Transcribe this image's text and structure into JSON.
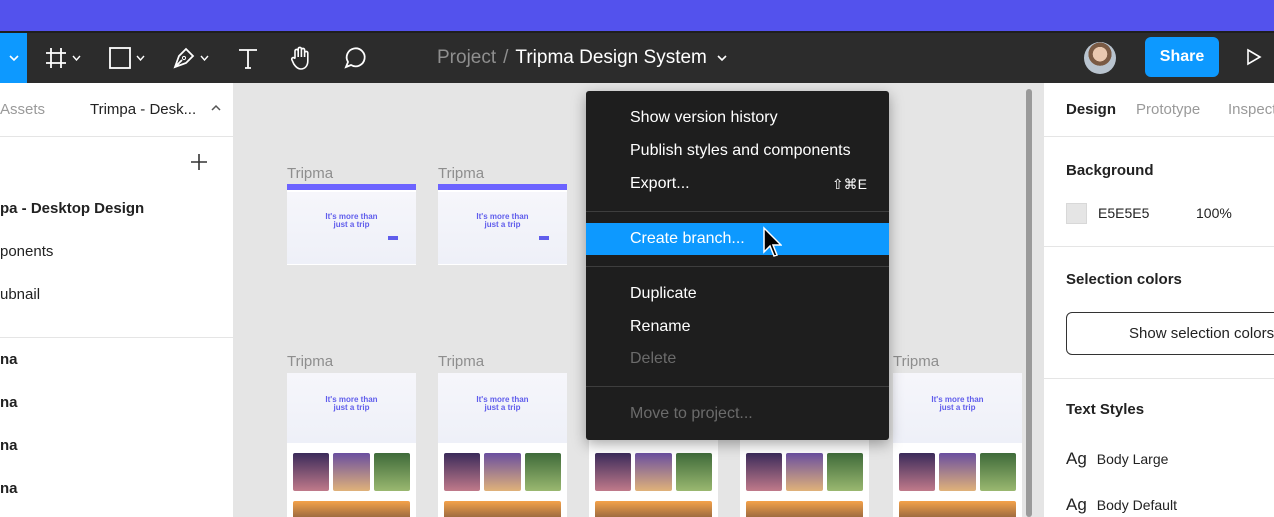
{
  "toolbar": {
    "project": "Project",
    "separator": "/",
    "title": "Tripma Design System",
    "share_label": "Share"
  },
  "left_panel": {
    "assets_tab": "Assets",
    "page_selector": "Trimpa - Desk...",
    "pages": [
      "pa - Desktop Design",
      "ponents",
      "ubnail"
    ],
    "layers": [
      "na",
      "na",
      "na",
      "na"
    ]
  },
  "canvas": {
    "frame_label": "Tripma",
    "hero_line1": "It's more than",
    "hero_line2": "just a trip",
    "brand": "Tripma"
  },
  "menu": {
    "items": [
      {
        "label": "Show version history",
        "shortcut": "",
        "disabled": false
      },
      {
        "label": "Publish styles and components",
        "shortcut": "",
        "disabled": false
      },
      {
        "label": "Export...",
        "shortcut": "⇧⌘E",
        "disabled": false
      },
      {
        "label": "Create branch...",
        "shortcut": "",
        "disabled": false
      },
      {
        "label": "Duplicate",
        "shortcut": "",
        "disabled": false
      },
      {
        "label": "Rename",
        "shortcut": "",
        "disabled": false
      },
      {
        "label": "Delete",
        "shortcut": "",
        "disabled": true
      },
      {
        "label": "Move to project...",
        "shortcut": "",
        "disabled": true
      }
    ],
    "highlighted": "Create branch..."
  },
  "right_panel": {
    "tabs": [
      "Design",
      "Prototype",
      "Inspect"
    ],
    "background_heading": "Background",
    "background_hex": "E5E5E5",
    "background_opacity": "100%",
    "selection_colors_heading": "Selection colors",
    "show_selection_colors": "Show selection colors",
    "text_styles_heading": "Text Styles",
    "text_styles": [
      {
        "icon": "Ag",
        "name": "Body Large"
      },
      {
        "icon": "Ag",
        "name": "Body Default"
      }
    ]
  },
  "colors": {
    "accent": "#0d99ff",
    "brand": "#605dec",
    "toolbar": "#2c2c2c",
    "top_strip": "#5352ed",
    "menu_bg": "#1e1e1e"
  },
  "icons": [
    "menu-chevron-icon",
    "frame-icon",
    "rectangle-icon",
    "pen-icon",
    "text-icon",
    "hand-icon",
    "comment-icon",
    "chevron-down-icon",
    "play-icon",
    "plus-icon",
    "cursor-icon"
  ]
}
